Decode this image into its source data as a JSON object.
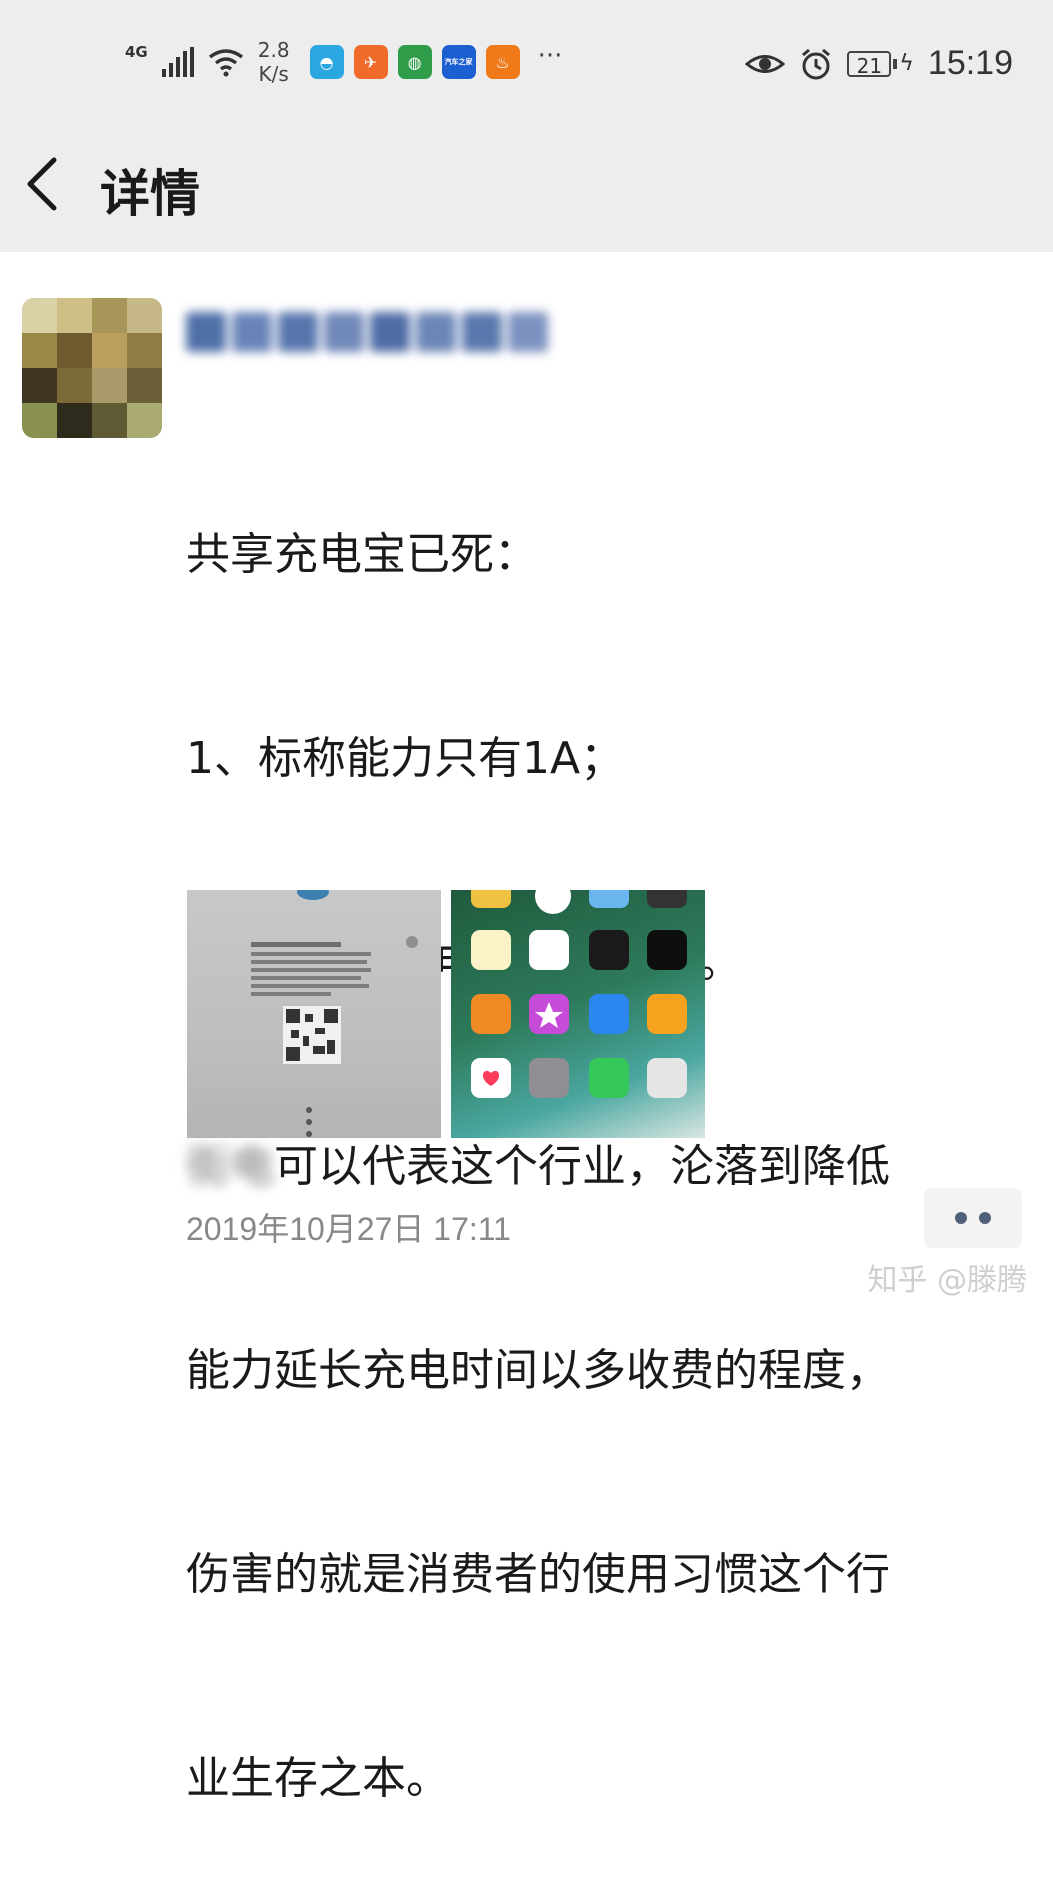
{
  "status_bar": {
    "network_type": "4G",
    "speed_value": "2.8",
    "speed_unit": "K/s",
    "battery_level": "21",
    "time": "15:19",
    "app_icons": [
      {
        "name": "browser-app-icon",
        "glyph": "◓",
        "color": "#2aa7e0"
      },
      {
        "name": "app-orange-icon",
        "glyph": "✈",
        "color": "#f06a2a"
      },
      {
        "name": "app-circle-icon",
        "glyph": "◍",
        "color": "#2f9c4a"
      },
      {
        "name": "car-home-app-icon",
        "glyph": "汽车之家",
        "color": "#1b5fd1"
      },
      {
        "name": "app-candle-icon",
        "glyph": "♨",
        "color": "#f07a1a"
      }
    ],
    "more": "···"
  },
  "header": {
    "title": "详情"
  },
  "post": {
    "lines": [
      "共享充电宝已死：",
      "1、标称能力只有1A；",
      "2、实际充电电流远达不到。"
    ],
    "blurred_prefix": "街电",
    "line4_rest": "可以代表这个行业，沦落到降低",
    "lines_tail": [
      "能力延长充电时间以多收费的程度，",
      "伤害的就是消费者的使用习惯这个行",
      "业生存之本。"
    ],
    "timestamp": "2019年10月27日 17:11"
  },
  "watermark": "知乎 @滕腾",
  "colors": {
    "header_bg": "#ededed",
    "text": "#1a1a1a",
    "timestamp": "#888888",
    "more_dot": "#51607a"
  }
}
